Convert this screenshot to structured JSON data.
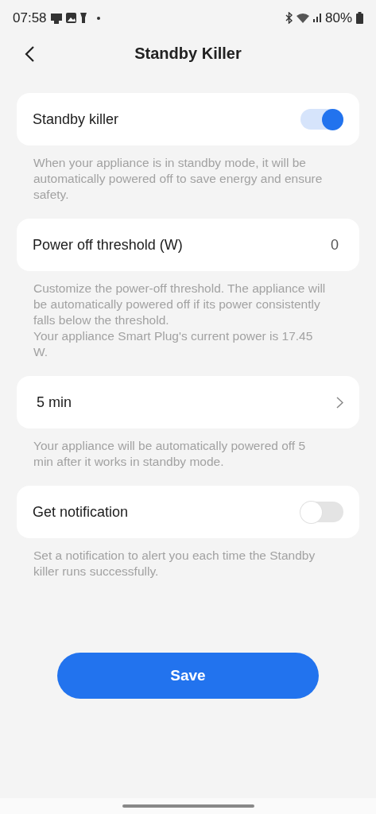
{
  "status_bar": {
    "time": "07:58",
    "battery": "80%"
  },
  "header": {
    "title": "Standby Killer"
  },
  "settings": [
    {
      "kind": "toggle",
      "label": "Standby killer",
      "on": true,
      "description": "When your appliance is in standby mode, it will be automatically powered off to save energy and ensure safety."
    },
    {
      "kind": "value",
      "label": "Power off threshold (W)",
      "value": "0",
      "description": "Customize the power-off threshold. The appliance will be automatically powered off if its power consistently falls below the threshold.\nYour appliance Smart Plug's current power is 17.45 W."
    },
    {
      "kind": "chevron",
      "label": "5 min",
      "description": "Your appliance will be automatically powered off  5 min after it works in standby mode."
    },
    {
      "kind": "toggle",
      "label": "Get notification",
      "on": false,
      "description": "Set a notification to alert you each time the Standby killer runs successfully."
    }
  ],
  "save_button": "Save"
}
